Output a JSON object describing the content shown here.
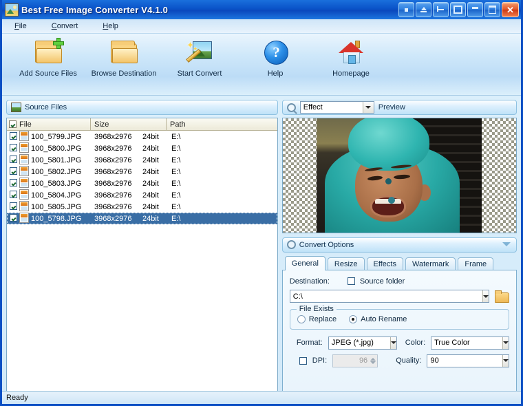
{
  "window": {
    "title": "Best Free Image Converter V4.1.0",
    "title_icon": "image-photo-icon",
    "buttons": [
      {
        "name": "stay-on-top-button",
        "glyph": "dot"
      },
      {
        "name": "roll-up-button",
        "glyph": "up"
      },
      {
        "name": "pin-button",
        "glyph": "pin"
      },
      {
        "name": "transparency-button",
        "glyph": "box"
      },
      {
        "name": "minimize-button",
        "glyph": "min"
      },
      {
        "name": "maximize-button",
        "glyph": "restore"
      },
      {
        "name": "close-button",
        "glyph": "x"
      }
    ]
  },
  "menu": {
    "items": [
      {
        "label": "File",
        "accel": "F"
      },
      {
        "label": "Convert",
        "accel": "C"
      },
      {
        "label": "Help",
        "accel": "H"
      }
    ]
  },
  "toolbar": {
    "items": [
      {
        "label": "Add Source Files",
        "icon": "folder-add-icon"
      },
      {
        "label": "Browse Destination",
        "icon": "folder-icon"
      },
      {
        "label": "Start Convert",
        "icon": "magic-wand-image-icon"
      },
      {
        "label": "Help",
        "icon": "question-mark-icon"
      },
      {
        "label": "Homepage",
        "icon": "house-icon"
      }
    ]
  },
  "source_panel": {
    "title": "Source Files",
    "icon": "image-photo-icon",
    "columns": [
      "File",
      "Size",
      "Path"
    ],
    "header_checkbox_checked": true,
    "rows": [
      {
        "checked": true,
        "file": "100_5799.JPG",
        "size": "3968x2976",
        "depth": "24bit",
        "path": "E:\\",
        "selected": false
      },
      {
        "checked": true,
        "file": "100_5800.JPG",
        "size": "3968x2976",
        "depth": "24bit",
        "path": "E:\\",
        "selected": false
      },
      {
        "checked": true,
        "file": "100_5801.JPG",
        "size": "3968x2976",
        "depth": "24bit",
        "path": "E:\\",
        "selected": false
      },
      {
        "checked": true,
        "file": "100_5802.JPG",
        "size": "3968x2976",
        "depth": "24bit",
        "path": "E:\\",
        "selected": false
      },
      {
        "checked": true,
        "file": "100_5803.JPG",
        "size": "3968x2976",
        "depth": "24bit",
        "path": "E:\\",
        "selected": false
      },
      {
        "checked": true,
        "file": "100_5804.JPG",
        "size": "3968x2976",
        "depth": "24bit",
        "path": "E:\\",
        "selected": false
      },
      {
        "checked": true,
        "file": "100_5805.JPG",
        "size": "3968x2976",
        "depth": "24bit",
        "path": "E:\\",
        "selected": false
      },
      {
        "checked": true,
        "file": "100_5798.JPG",
        "size": "3968x2976",
        "depth": "24bit",
        "path": "E:\\",
        "selected": true
      }
    ]
  },
  "preview_panel": {
    "effect_value": "Effect",
    "effect_icon": "magnifier-icon",
    "label": "Preview",
    "image_alt": "smiling baby wearing teal knit cap and sweater"
  },
  "convert_options": {
    "title": "Convert Options",
    "icon": "gear-icon",
    "collapse_icon": "chevron-down-icon",
    "tabs": [
      {
        "label": "General",
        "active": true
      },
      {
        "label": "Resize",
        "active": false
      },
      {
        "label": "Effects",
        "active": false
      },
      {
        "label": "Watermark",
        "active": false
      },
      {
        "label": "Frame",
        "active": false
      }
    ],
    "general": {
      "destination_label": "Destination:",
      "source_folder_label": "Source folder",
      "source_folder_checked": false,
      "destination_value": "C:\\",
      "browse_icon": "folder-icon",
      "file_exists_group": "File Exists",
      "replace_label": "Replace",
      "replace_selected": false,
      "auto_rename_label": "Auto Rename",
      "auto_rename_selected": true,
      "format_label": "Format:",
      "format_value": "JPEG (*.jpg)",
      "color_label": "Color:",
      "color_value": "True Color",
      "dpi_label": "DPI:",
      "dpi_checked": false,
      "dpi_value": "96",
      "quality_label": "Quality:",
      "quality_value": "90"
    }
  },
  "statusbar": {
    "text": "Ready"
  },
  "colors": {
    "title_blue": "#0a53c8",
    "accent_blue": "#1a6fdc",
    "selection_blue": "#3a6ea5",
    "close_red": "#e2572a",
    "panel_bg": "#d6ecfa"
  }
}
